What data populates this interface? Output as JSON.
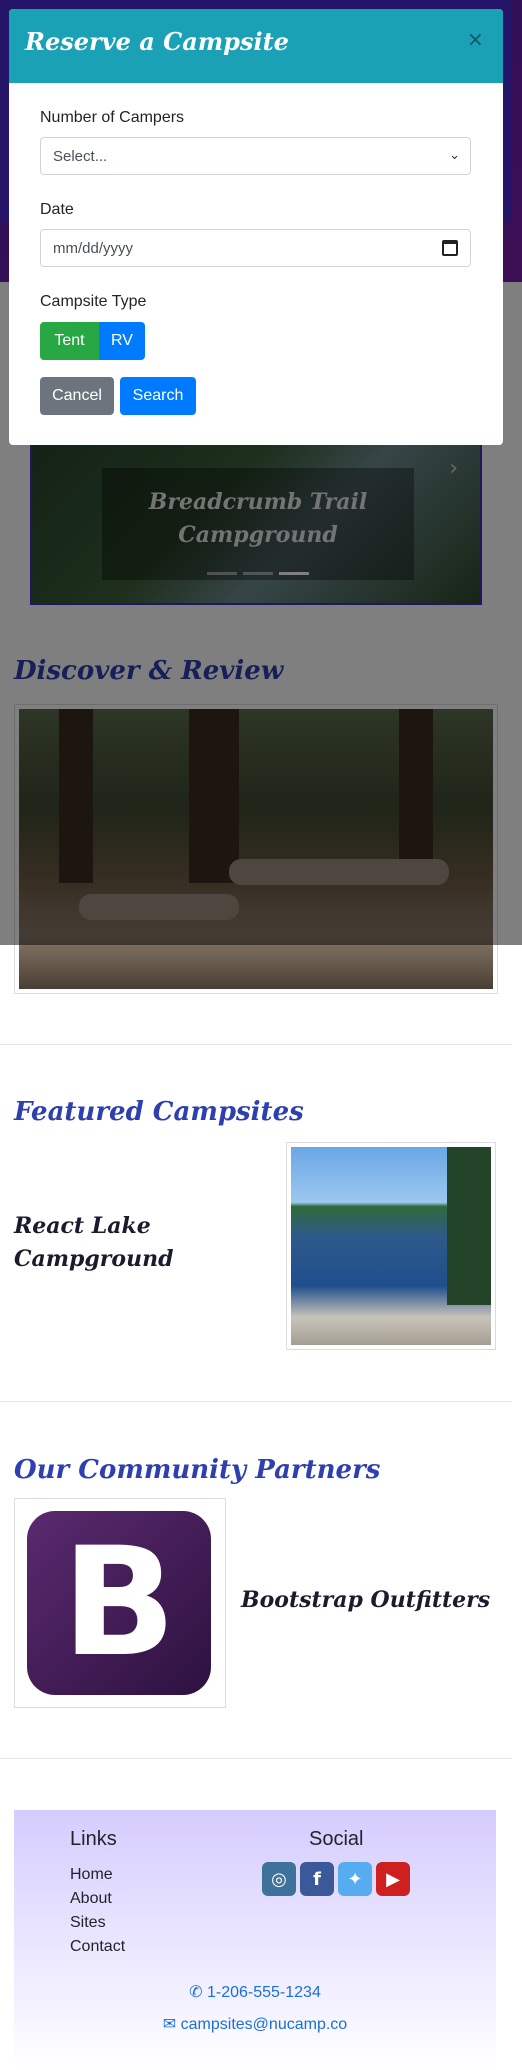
{
  "carousel": {
    "caption": "Breadcrumb Trail Campground",
    "next_icon": "›",
    "indicator_count": 3,
    "active_indicator": 3
  },
  "discover": {
    "heading": "Discover & Review"
  },
  "featured": {
    "heading": "Featured Campsites",
    "title": "React Lake Campground"
  },
  "partners": {
    "heading": "Our Community Partners",
    "name": "Bootstrap Outfitters",
    "logo_letter": "B"
  },
  "footer": {
    "links_heading": "Links",
    "links": [
      "Home",
      "About",
      "Sites",
      "Contact"
    ],
    "social_heading": "Social",
    "social": [
      {
        "icon": "instagram-icon",
        "glyph": "◎",
        "color": "#3f729b"
      },
      {
        "icon": "facebook-icon",
        "glyph": "f",
        "color": "#3b5998"
      },
      {
        "icon": "twitter-icon",
        "glyph": "✦",
        "color": "#55acee"
      },
      {
        "icon": "youtube-icon",
        "glyph": "▶",
        "color": "#cd201f"
      }
    ],
    "phone": "1-206-555-1234",
    "email": "campsites@nucamp.co"
  },
  "modal": {
    "title": "Reserve a Campsite",
    "close_glyph": "×",
    "campers_label": "Number of Campers",
    "campers_value": "Select...",
    "date_label": "Date",
    "date_placeholder": "mm/dd/yyyy",
    "type_label": "Campsite Type",
    "type_tent": "Tent",
    "type_rv": "RV",
    "cancel": "Cancel",
    "search": "Search"
  },
  "colors": {
    "header": "#1aa1b6",
    "heading": "#2e3fb0",
    "success": "#28a745",
    "primary": "#007bff",
    "secondary": "#6c757d"
  }
}
